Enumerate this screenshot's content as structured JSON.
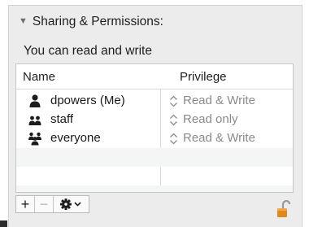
{
  "section": {
    "title": "Sharing & Permissions:",
    "access_text": "You can read and write"
  },
  "table": {
    "columns": {
      "name": "Name",
      "privilege": "Privilege"
    },
    "rows": [
      {
        "name": "dpowers (Me)",
        "privilege": "Read & Write",
        "icon": "single-user-icon"
      },
      {
        "name": "staff",
        "privilege": "Read only",
        "icon": "group-users-icon"
      },
      {
        "name": "everyone",
        "privilege": "Read & Write",
        "icon": "everyone-users-icon"
      }
    ]
  },
  "toolbar": {
    "add_label": "+",
    "remove_label": "−",
    "action_icon": "gear-icon"
  },
  "lock": {
    "state": "unlocked",
    "icon": "padlock-icon",
    "color": "#e08a1e"
  },
  "colors": {
    "panel_bg": "#ececec",
    "row_alt": "#f4f5f5",
    "muted_text": "#8a8a8a"
  }
}
